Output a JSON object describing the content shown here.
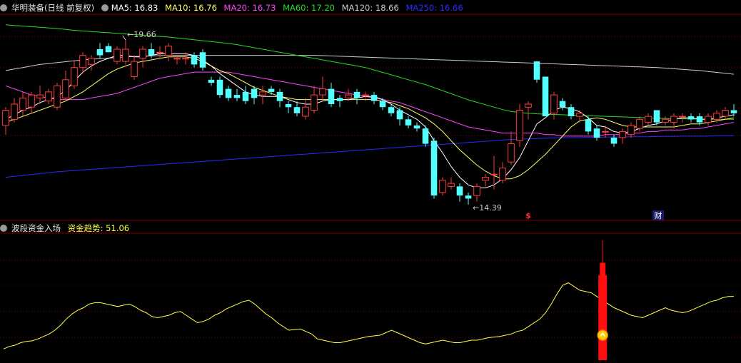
{
  "main_header": {
    "title": "华明装备(日线 前复权)",
    "ma5": "MA5: 16.83",
    "ma10": "MA10: 16.76",
    "ma20": "MA20: 16.73",
    "ma60": "MA60: 17.20",
    "ma120": "MA120: 18.66",
    "ma250": "MA250: 16.66"
  },
  "sub_header": {
    "title": "波段资金入场",
    "indicator": "资金趋势: 51.06"
  },
  "annotations": {
    "high": "19.66",
    "low": "14.39",
    "marker_s": "$",
    "marker_cai": "财"
  },
  "colors": {
    "up": "#ff3c3c",
    "down": "#54ffff",
    "ma5": "#ffffff",
    "ma10": "#ffff66",
    "ma20": "#ff44ff",
    "ma60": "#22dd22",
    "ma120": "#cccccc",
    "ma250": "#2a2aff",
    "trend": "#ffff44",
    "bar": "#ff1010",
    "grid": "#800000"
  },
  "chart_data": [
    {
      "type": "candlestick",
      "title": "华明装备(日线 前复权)",
      "y_high_label": 19.66,
      "y_low_label": 14.39,
      "candles": [
        [
          17.0,
          17.5,
          16.7,
          17.6
        ],
        [
          17.2,
          17.7,
          17.1,
          17.9
        ],
        [
          17.5,
          17.9,
          17.3,
          18.1
        ],
        [
          17.6,
          18.0,
          17.4,
          18.1
        ],
        [
          17.9,
          18.0,
          17.7,
          18.3
        ],
        [
          17.8,
          18.1,
          17.7,
          18.2
        ],
        [
          17.6,
          18.3,
          17.5,
          18.4
        ],
        [
          17.9,
          18.5,
          17.8,
          18.8
        ],
        [
          18.3,
          18.9,
          18.2,
          19.1
        ],
        [
          18.9,
          19.3,
          18.7,
          19.4
        ],
        [
          19.0,
          19.2,
          18.8,
          19.3
        ],
        [
          19.5,
          19.3,
          19.2,
          19.7
        ],
        [
          19.6,
          19.4,
          19.4,
          19.7
        ],
        [
          19.1,
          19.5,
          19.0,
          19.6
        ],
        [
          19.1,
          19.5,
          19.0,
          19.8
        ],
        [
          18.6,
          19.1,
          18.5,
          19.3
        ],
        [
          19.2,
          19.5,
          18.9,
          19.6
        ],
        [
          19.5,
          19.3,
          19.2,
          19.7
        ],
        [
          19.4,
          19.4,
          19.2,
          19.6
        ],
        [
          19.3,
          19.6,
          19.1,
          19.7
        ],
        [
          19.2,
          19.2,
          19.0,
          19.3
        ],
        [
          19.2,
          19.2,
          19.0,
          19.4
        ],
        [
          19.3,
          19.0,
          18.9,
          19.4
        ],
        [
          19.4,
          18.9,
          18.8,
          19.5
        ],
        [
          18.5,
          18.4,
          18.3,
          18.6
        ],
        [
          18.5,
          18.0,
          17.9,
          18.6
        ],
        [
          18.2,
          17.9,
          17.8,
          18.3
        ],
        [
          18.0,
          17.9,
          17.8,
          18.2
        ],
        [
          18.1,
          17.8,
          17.7,
          18.3
        ],
        [
          18.2,
          17.9,
          17.7,
          18.3
        ],
        [
          18.0,
          18.1,
          17.7,
          18.3
        ],
        [
          18.2,
          18.1,
          18.0,
          18.3
        ],
        [
          18.1,
          17.8,
          17.6,
          18.2
        ],
        [
          17.7,
          17.6,
          17.4,
          17.8
        ],
        [
          17.6,
          17.4,
          17.3,
          17.8
        ],
        [
          17.3,
          17.6,
          17.2,
          17.9
        ],
        [
          17.5,
          18.0,
          17.4,
          18.3
        ],
        [
          18.0,
          18.2,
          17.8,
          18.6
        ],
        [
          18.2,
          17.7,
          17.6,
          18.4
        ],
        [
          17.9,
          17.8,
          17.6,
          18.0
        ],
        [
          17.9,
          18.0,
          17.8,
          18.2
        ],
        [
          18.1,
          17.9,
          17.7,
          18.2
        ],
        [
          18.0,
          18.0,
          17.8,
          18.1
        ],
        [
          18.0,
          17.8,
          17.7,
          18.1
        ],
        [
          17.8,
          17.6,
          17.5,
          17.9
        ],
        [
          17.6,
          17.4,
          17.3,
          17.7
        ],
        [
          17.5,
          17.2,
          17.0,
          17.6
        ],
        [
          17.2,
          17.0,
          16.9,
          17.3
        ],
        [
          17.0,
          16.9,
          16.8,
          17.1
        ],
        [
          16.9,
          16.4,
          16.3,
          17.0
        ],
        [
          16.5,
          14.7,
          14.6,
          16.6
        ],
        [
          14.8,
          15.2,
          14.7,
          15.3
        ],
        [
          15.0,
          15.1,
          14.9,
          15.3
        ],
        [
          15.0,
          14.7,
          14.5,
          15.1
        ],
        [
          14.7,
          14.6,
          14.4,
          14.8
        ],
        [
          14.7,
          15.0,
          14.5,
          15.1
        ],
        [
          15.2,
          15.3,
          15.0,
          15.4
        ],
        [
          15.4,
          15.4,
          14.9,
          16.0
        ],
        [
          15.2,
          15.6,
          15.1,
          15.8
        ],
        [
          15.8,
          16.4,
          15.7,
          16.8
        ],
        [
          16.5,
          17.5,
          16.3,
          17.7
        ],
        [
          17.6,
          17.7,
          17.2,
          17.8
        ],
        [
          19.1,
          18.5,
          18.4,
          19.1
        ],
        [
          18.6,
          17.3,
          17.3,
          17.8
        ],
        [
          17.4,
          18.0,
          17.2,
          18.1
        ],
        [
          17.8,
          17.6,
          17.5,
          17.9
        ],
        [
          17.6,
          17.3,
          17.2,
          17.7
        ],
        [
          17.3,
          17.4,
          17.1,
          17.5
        ],
        [
          17.2,
          16.8,
          16.7,
          17.3
        ],
        [
          16.9,
          16.6,
          16.5,
          17.0
        ],
        [
          16.8,
          16.8,
          16.6,
          17.0
        ],
        [
          16.6,
          16.4,
          16.3,
          16.7
        ],
        [
          16.6,
          16.8,
          16.4,
          16.9
        ],
        [
          16.7,
          17.0,
          16.6,
          17.1
        ],
        [
          16.9,
          17.2,
          16.8,
          17.3
        ],
        [
          17.1,
          17.3,
          17.0,
          17.4
        ],
        [
          17.5,
          17.1,
          17.0,
          17.5
        ],
        [
          17.1,
          17.2,
          17.0,
          17.3
        ],
        [
          17.1,
          17.3,
          16.9,
          17.4
        ],
        [
          17.3,
          17.3,
          17.1,
          17.4
        ],
        [
          17.3,
          17.2,
          17.1,
          17.4
        ],
        [
          17.3,
          17.1,
          17.0,
          17.4
        ],
        [
          17.1,
          17.3,
          17.0,
          17.4
        ],
        [
          17.2,
          17.4,
          17.1,
          17.5
        ],
        [
          17.3,
          17.5,
          17.2,
          17.6
        ],
        [
          17.5,
          17.4,
          17.3,
          17.7
        ]
      ],
      "ma5": [
        17.2,
        17.35,
        17.5,
        17.6,
        17.75,
        17.85,
        17.95,
        18.15,
        18.45,
        18.75,
        18.95,
        19.1,
        19.2,
        19.3,
        19.3,
        19.25,
        19.25,
        19.3,
        19.35,
        19.35,
        19.35,
        19.35,
        19.3,
        19.15,
        18.95,
        18.7,
        18.5,
        18.3,
        18.1,
        18.0,
        17.95,
        17.95,
        17.95,
        17.85,
        17.75,
        17.7,
        17.7,
        17.8,
        17.85,
        17.85,
        17.85,
        17.9,
        17.95,
        17.95,
        17.85,
        17.7,
        17.5,
        17.35,
        17.2,
        16.95,
        16.5,
        16.1,
        15.65,
        15.3,
        15.05,
        14.95,
        14.95,
        15.05,
        15.25,
        15.55,
        15.95,
        16.5,
        17.05,
        17.25,
        17.5,
        17.6,
        17.55,
        17.45,
        17.25,
        17.0,
        16.95,
        16.8,
        16.75,
        16.8,
        16.9,
        17.0,
        17.05,
        17.15,
        17.2,
        17.25,
        17.25,
        17.2,
        17.2,
        17.25,
        17.3,
        17.35
      ],
      "ma10": [
        17.1,
        17.2,
        17.3,
        17.4,
        17.5,
        17.6,
        17.7,
        17.8,
        17.95,
        18.1,
        18.3,
        18.5,
        18.7,
        18.85,
        18.95,
        19.05,
        19.1,
        19.15,
        19.2,
        19.25,
        19.25,
        19.25,
        19.2,
        19.1,
        18.95,
        18.8,
        18.7,
        18.55,
        18.4,
        18.25,
        18.15,
        18.05,
        17.95,
        17.9,
        17.85,
        17.85,
        17.85,
        17.85,
        17.85,
        17.85,
        17.85,
        17.85,
        17.85,
        17.85,
        17.8,
        17.75,
        17.65,
        17.55,
        17.4,
        17.25,
        17.05,
        16.8,
        16.5,
        16.2,
        15.95,
        15.7,
        15.5,
        15.35,
        15.25,
        15.25,
        15.35,
        15.55,
        15.8,
        16.05,
        16.35,
        16.65,
        16.95,
        17.15,
        17.2,
        17.25,
        17.2,
        17.1,
        17.0,
        16.95,
        16.95,
        16.95,
        16.95,
        16.95,
        16.95,
        17.0,
        17.05,
        17.05,
        17.1,
        17.15,
        17.2,
        17.25
      ],
      "ma20": [
        18.3,
        18.2,
        18.1,
        18.0,
        17.95,
        17.9,
        17.85,
        17.85,
        17.85,
        17.85,
        17.9,
        17.95,
        18.0,
        18.05,
        18.15,
        18.25,
        18.35,
        18.45,
        18.55,
        18.6,
        18.65,
        18.7,
        18.75,
        18.75,
        18.75,
        18.75,
        18.75,
        18.7,
        18.65,
        18.6,
        18.55,
        18.5,
        18.45,
        18.4,
        18.35,
        18.3,
        18.25,
        18.2,
        18.15,
        18.1,
        18.05,
        18.0,
        17.95,
        17.9,
        17.85,
        17.8,
        17.75,
        17.65,
        17.55,
        17.45,
        17.35,
        17.25,
        17.15,
        17.05,
        16.95,
        16.9,
        16.85,
        16.8,
        16.75,
        16.75,
        16.75,
        16.75,
        16.75,
        16.7,
        16.7,
        16.65,
        16.65,
        16.65,
        16.65,
        16.65,
        16.7,
        16.7,
        16.7,
        16.75,
        16.75,
        16.8,
        16.8,
        16.85,
        16.85,
        16.85,
        16.9,
        16.9,
        16.95,
        17.0,
        17.05,
        17.1
      ],
      "ma60": [
        20.3,
        20.28,
        20.26,
        20.24,
        20.22,
        20.2,
        20.18,
        20.15,
        20.12,
        20.1,
        20.08,
        20.06,
        20.04,
        20.02,
        20.0,
        19.98,
        19.96,
        19.94,
        19.92,
        19.9,
        19.87,
        19.84,
        19.81,
        19.78,
        19.75,
        19.72,
        19.69,
        19.65,
        19.6,
        19.55,
        19.5,
        19.45,
        19.4,
        19.35,
        19.3,
        19.25,
        19.2,
        19.15,
        19.1,
        19.05,
        19.0,
        18.95,
        18.9,
        18.82,
        18.74,
        18.66,
        18.58,
        18.5,
        18.42,
        18.34,
        18.24,
        18.14,
        18.04,
        17.94,
        17.84,
        17.76,
        17.68,
        17.6,
        17.52,
        17.46,
        17.42,
        17.4,
        17.38,
        17.37,
        17.36,
        17.35,
        17.34,
        17.33,
        17.32,
        17.31,
        17.3,
        17.29,
        17.28,
        17.27,
        17.26,
        17.25,
        17.24,
        17.23,
        17.22,
        17.22,
        17.21,
        17.21,
        17.2,
        17.2,
        17.2,
        17.2
      ],
      "ma120": [
        18.8,
        18.85,
        18.9,
        18.95,
        19.0,
        19.03,
        19.06,
        19.09,
        19.12,
        19.15,
        19.17,
        19.19,
        19.21,
        19.23,
        19.25,
        19.26,
        19.27,
        19.28,
        19.29,
        19.3,
        19.3,
        19.3,
        19.3,
        19.3,
        19.3,
        19.3,
        19.3,
        19.3,
        19.3,
        19.3,
        19.3,
        19.3,
        19.3,
        19.3,
        19.3,
        19.3,
        19.3,
        19.29,
        19.28,
        19.27,
        19.26,
        19.25,
        19.24,
        19.23,
        19.22,
        19.21,
        19.2,
        19.19,
        19.18,
        19.17,
        19.16,
        19.15,
        19.14,
        19.13,
        19.12,
        19.11,
        19.1,
        19.09,
        19.08,
        19.07,
        19.06,
        19.05,
        19.04,
        19.03,
        19.02,
        19.01,
        19.0,
        18.99,
        18.98,
        18.97,
        18.96,
        18.95,
        18.94,
        18.93,
        18.92,
        18.91,
        18.9,
        18.88,
        18.86,
        18.84,
        18.82,
        18.8,
        18.77,
        18.74,
        18.71,
        18.68
      ],
      "ma250": [
        15.3,
        15.33,
        15.36,
        15.39,
        15.42,
        15.45,
        15.48,
        15.5,
        15.52,
        15.54,
        15.56,
        15.58,
        15.6,
        15.62,
        15.64,
        15.66,
        15.68,
        15.7,
        15.72,
        15.74,
        15.76,
        15.78,
        15.8,
        15.82,
        15.84,
        15.86,
        15.88,
        15.9,
        15.92,
        15.94,
        15.96,
        15.98,
        16.0,
        16.02,
        16.04,
        16.06,
        16.08,
        16.1,
        16.12,
        16.14,
        16.16,
        16.18,
        16.2,
        16.22,
        16.24,
        16.26,
        16.28,
        16.3,
        16.32,
        16.34,
        16.36,
        16.38,
        16.4,
        16.42,
        16.44,
        16.46,
        16.48,
        16.5,
        16.52,
        16.54,
        16.55,
        16.56,
        16.57,
        16.58,
        16.59,
        16.6,
        16.6,
        16.6,
        16.61,
        16.61,
        16.62,
        16.62,
        16.62,
        16.63,
        16.63,
        16.63,
        16.64,
        16.64,
        16.64,
        16.65,
        16.65,
        16.65,
        16.65,
        16.66,
        16.66,
        16.66
      ]
    },
    {
      "type": "line",
      "title": "波段资金入场",
      "series_name": "资金趋势",
      "ylim": [
        0,
        100
      ],
      "trend": [
        9,
        11,
        12,
        14,
        15,
        15.5,
        17,
        19,
        21,
        24,
        28,
        33,
        37,
        40,
        42,
        45,
        46,
        46,
        45,
        44,
        43,
        44,
        45,
        43,
        40,
        38,
        35,
        34,
        35,
        36,
        38,
        39,
        36,
        33,
        30,
        31,
        33,
        36,
        38,
        41,
        43,
        45,
        47,
        48,
        45,
        41,
        37,
        34,
        30,
        27,
        24,
        24.5,
        25,
        23,
        21,
        17,
        16,
        15,
        14,
        14,
        15,
        16,
        17,
        18,
        19,
        19.5,
        20,
        22,
        24,
        22,
        20,
        18,
        16,
        14,
        13,
        14,
        15,
        16,
        15,
        14,
        14,
        15,
        16,
        16,
        17,
        18,
        18.5,
        19,
        20,
        21,
        23,
        24,
        27,
        30,
        33,
        38,
        45,
        53,
        60,
        62,
        59,
        56,
        55,
        54,
        51,
        48,
        45,
        42,
        40,
        38,
        36,
        35,
        34,
        36,
        38,
        40,
        42,
        40,
        39,
        38,
        39,
        41,
        43,
        45,
        47,
        48,
        50,
        51,
        51.06
      ],
      "signal_index": 105,
      "bar_levels": [
        [
          "thin",
          96
        ],
        [
          "mid",
          78
        ],
        [
          "wide",
          68
        ]
      ]
    }
  ]
}
